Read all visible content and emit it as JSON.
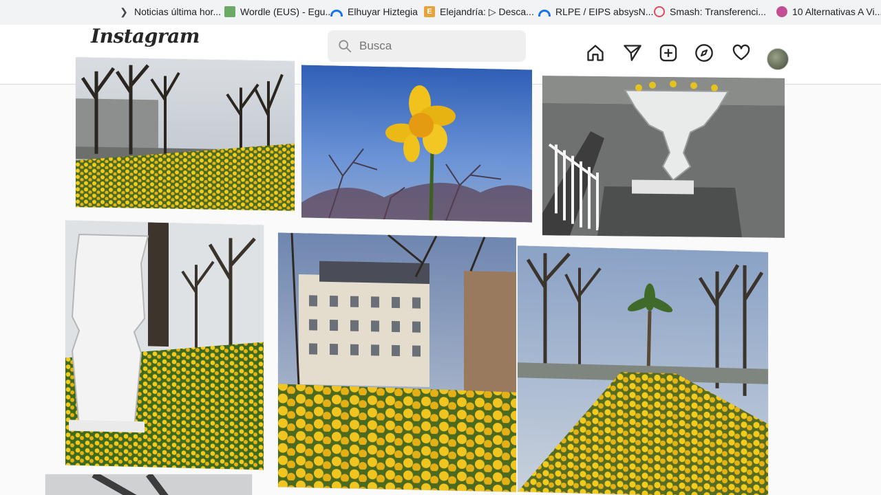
{
  "bookmarks": [
    {
      "label": "Noticias última hor...",
      "icon": "news-icon"
    },
    {
      "label": "Wordle (EUS) - Egu...",
      "icon": "wordle-icon"
    },
    {
      "label": "Elhuyar Hiztegia",
      "icon": "arc-icon"
    },
    {
      "label": "Elejandría: ▷ Desca...",
      "icon": "elejandria-icon"
    },
    {
      "label": "RLPE / EIPS absysN...",
      "icon": "arc-icon"
    },
    {
      "label": "Smash: Transferenci...",
      "icon": "smash-icon"
    },
    {
      "label": "10 Alternativas A Vi...",
      "icon": "alternativas-icon"
    }
  ],
  "header": {
    "logo": "Instagram",
    "search_placeholder": "Busca",
    "nav_icons": [
      "home-icon",
      "direct-icon",
      "new-post-icon",
      "explore-icon",
      "activity-icon",
      "profile-avatar"
    ]
  },
  "posts": [
    {
      "subject": "daffodil field with bare trees along promenade"
    },
    {
      "subject": "single daffodil against blue sky"
    },
    {
      "subject": "stone urn on balustrade by river"
    },
    {
      "subject": "white statue fountain with daffodils"
    },
    {
      "subject": "historic building behind daffodils"
    },
    {
      "subject": "daffodil field with palm tree and avenue"
    }
  ],
  "colors": {
    "daffodil": "#f0c21b",
    "sky": "#4f78c7",
    "header_bg": "#ffffff",
    "bookmarks_bg": "#f1f3f4"
  }
}
